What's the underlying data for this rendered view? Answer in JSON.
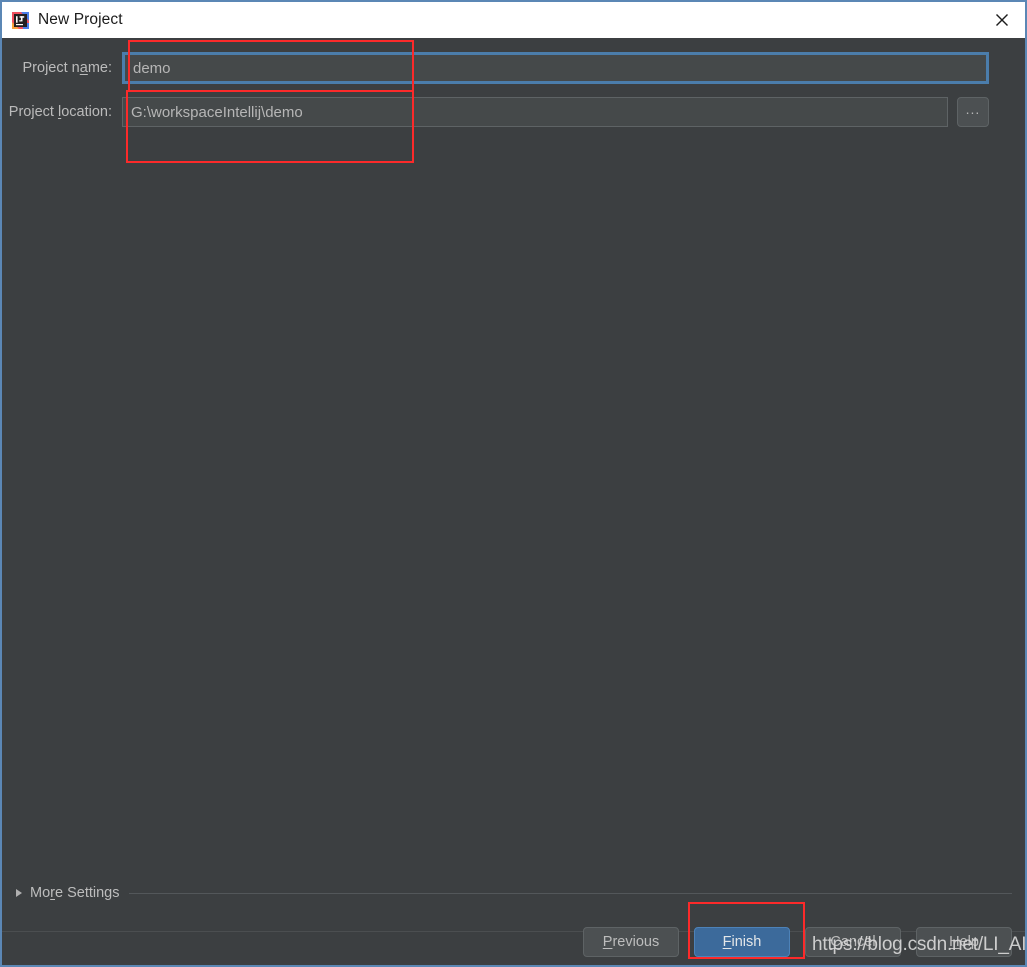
{
  "window": {
    "title": "New Project",
    "app_icon": "intellij-idea-icon",
    "close_icon": "close-icon",
    "accent_color": "#5b87b5",
    "background_color": "#3c3f41",
    "titlebar_color": "#ffffff"
  },
  "form": {
    "fields": [
      {
        "label_before": "Project n",
        "label_mnemonic": "a",
        "label_after": "me:",
        "value": "demo",
        "focused": true,
        "has_browse": false
      },
      {
        "label_before": "Project ",
        "label_mnemonic": "l",
        "label_after": "ocation:",
        "value": "G:\\workspaceIntellij\\demo",
        "focused": false,
        "has_browse": true,
        "browse_label": "..."
      }
    ]
  },
  "more_settings": {
    "before": "Mo",
    "mnemonic": "r",
    "after": "e Settings",
    "expanded": false,
    "disclosure_icon": "chevron-right-icon"
  },
  "buttons": [
    {
      "before": "",
      "mnemonic": "P",
      "after": "revious",
      "primary": false
    },
    {
      "before": "",
      "mnemonic": "F",
      "after": "inish",
      "primary": true
    },
    {
      "before": "",
      "mnemonic": "C",
      "after": "ancel",
      "primary": false
    },
    {
      "before": "",
      "mnemonic": "H",
      "after": "elp",
      "primary": false
    }
  ],
  "annotations": {
    "color": "#fc2a2a",
    "boxes": [
      {
        "name": "project-name-highlight"
      },
      {
        "name": "project-location-highlight"
      },
      {
        "name": "finish-button-highlight"
      }
    ]
  },
  "watermark": {
    "text": "https://blog.csdn.net/LI_AINY"
  }
}
